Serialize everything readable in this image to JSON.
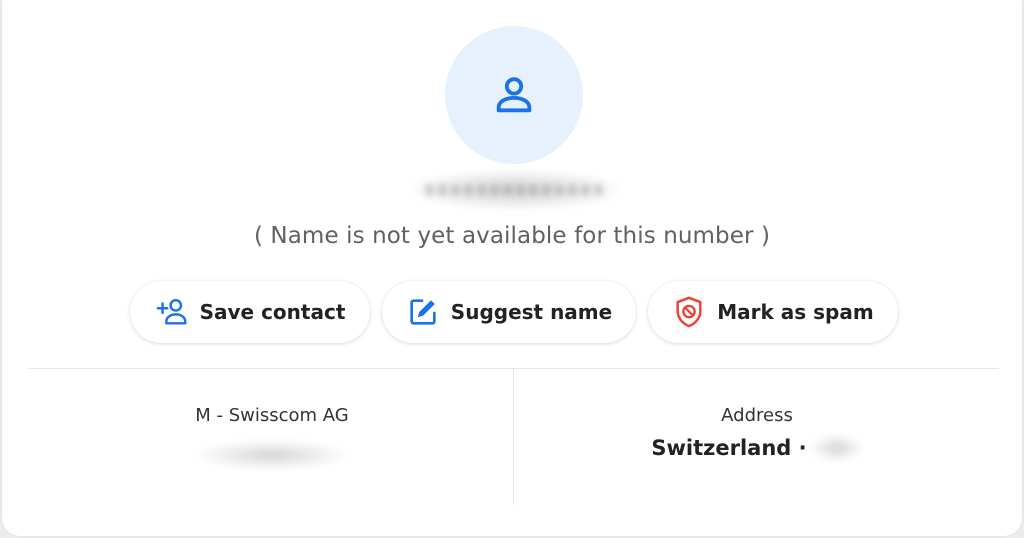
{
  "profile": {
    "avatar_icon": "person-icon",
    "not_available_text": "( Name is not yet available for this number )"
  },
  "actions": {
    "save_contact": {
      "label": "Save contact",
      "icon": "add-person-icon"
    },
    "suggest_name": {
      "label": "Suggest name",
      "icon": "edit-icon"
    },
    "mark_spam": {
      "label": "Mark as spam",
      "icon": "shield-block-icon"
    }
  },
  "details": {
    "carrier": {
      "title": "M - Swisscom AG"
    },
    "address": {
      "title": "Address",
      "value": "Switzerland ·"
    }
  },
  "colors": {
    "accent_blue": "#1a73e8",
    "avatar_bg": "#e6f1fd",
    "spam_red": "#ea4335",
    "text_dark": "#222222",
    "text_muted": "#616161"
  }
}
